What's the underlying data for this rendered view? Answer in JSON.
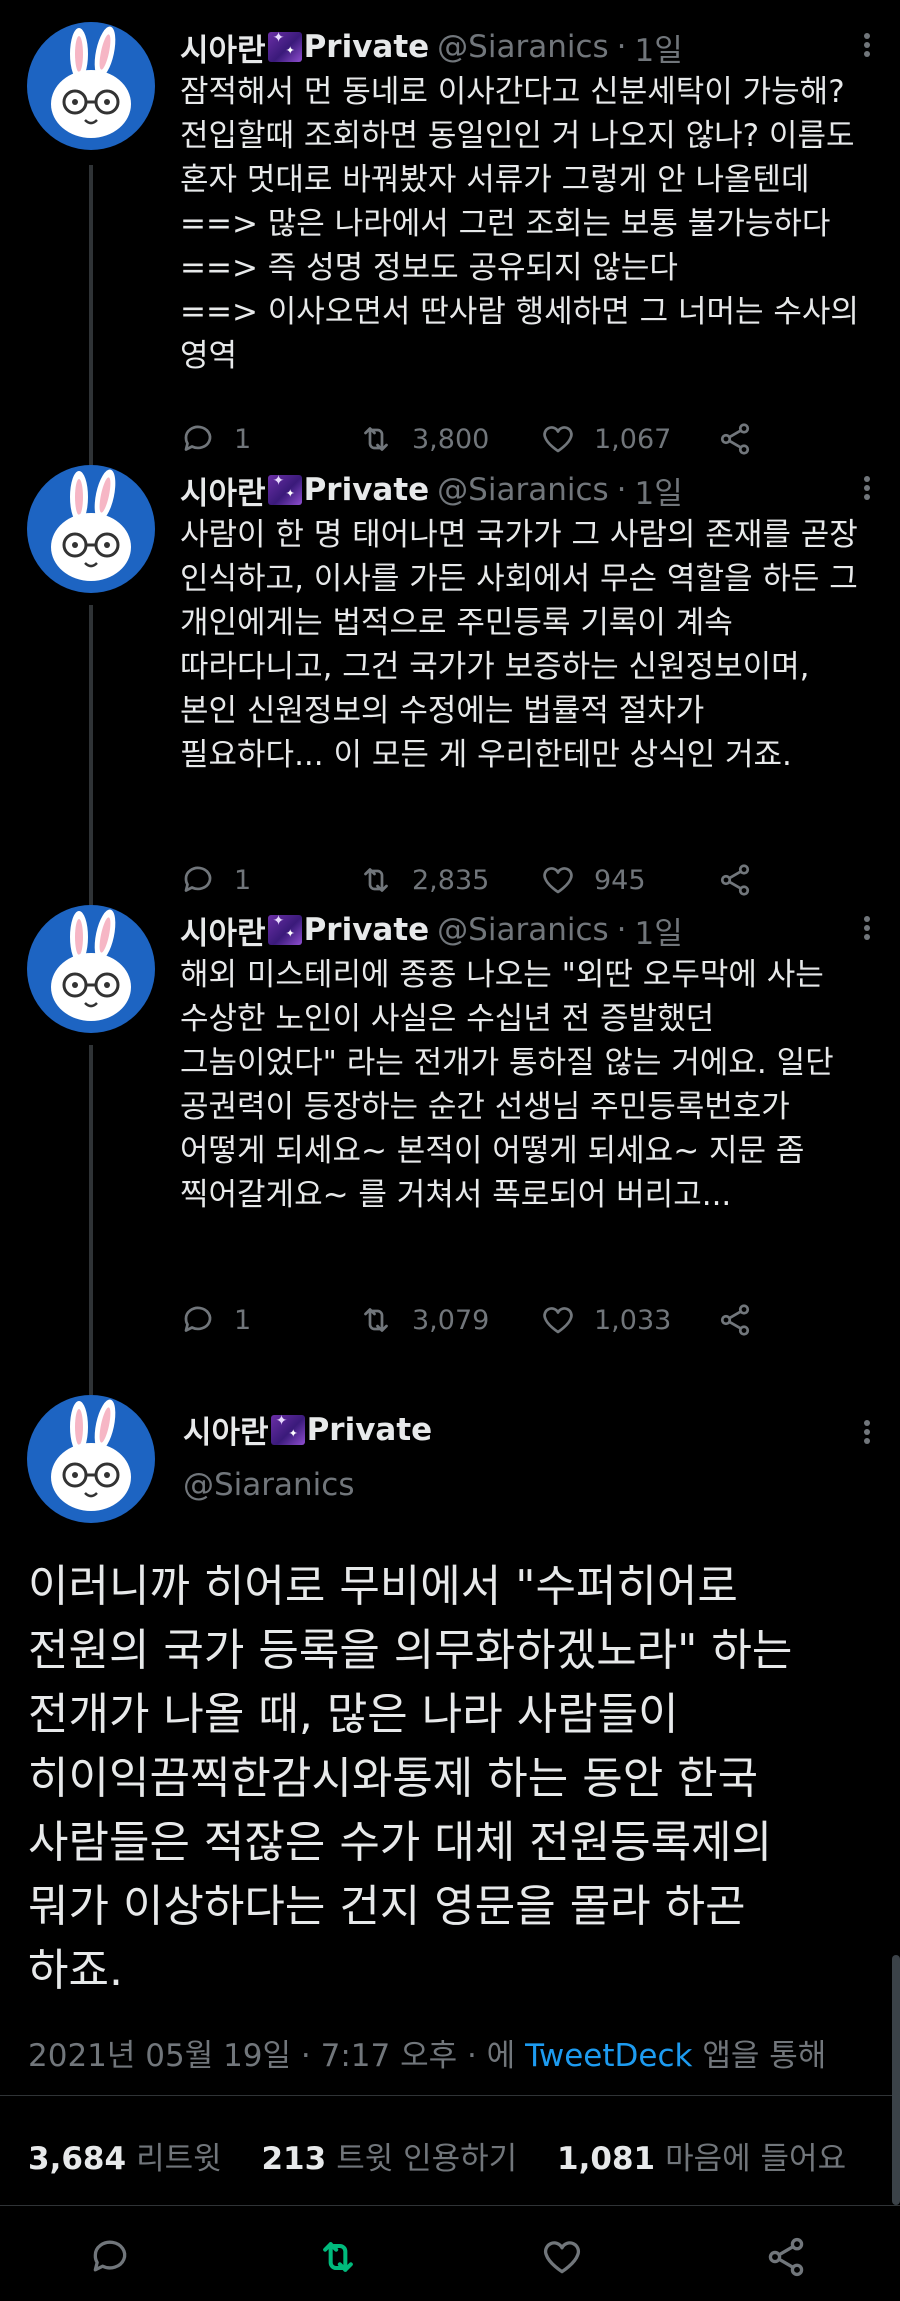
{
  "author": {
    "name": "시아란",
    "name_suffix": "Private",
    "handle": "@Siaranics",
    "avatar": "rabbit-avatar"
  },
  "tweets": [
    {
      "time": "1일",
      "lines": [
        "잠적해서 먼 동네로 이사간다고 신분세탁이 가능해?",
        "전입할때 조회하면 동일인인 거 나오지 않나? 이름도",
        "혼자 멋대로 바꿔봤자 서류가 그렇게 안 나올텐데",
        "==> 많은 나라에서 그런 조회는 보통 불가능하다",
        "==> 즉 성명 정보도 공유되지 않는다",
        "==> 이사오면서 딴사람 행세하면 그 너머는 수사의",
        "영역"
      ],
      "replies": "1",
      "retweets": "3,800",
      "likes": "1,067"
    },
    {
      "time": "1일",
      "lines": [
        "사람이 한 명 태어나면 국가가 그 사람의 존재를 곧장",
        "인식하고, 이사를 가든 사회에서 무슨 역할을 하든 그",
        "개인에게는 법적으로 주민등록 기록이 계속",
        "따라다니고, 그건 국가가 보증하는 신원정보이며,",
        "본인 신원정보의 수정에는 법률적 절차가",
        "필요하다... 이 모든 게 우리한테만 상식인 거죠."
      ],
      "replies": "1",
      "retweets": "2,835",
      "likes": "945"
    },
    {
      "time": "1일",
      "lines": [
        "해외 미스테리에 종종 나오는 \"외딴 오두막에 사는",
        "수상한 노인이 사실은 수십년 전 증발했던",
        "그놈이었다\" 라는 전개가 통하질 않는 거에요. 일단",
        "공권력이 등장하는 순간 선생님 주민등록번호가",
        "어떻게 되세요~ 본적이 어떻게 되세요~ 지문 좀",
        "찍어갈게요~ 를 거쳐서 폭로되어 버리고..."
      ],
      "replies": "1",
      "retweets": "3,079",
      "likes": "1,033"
    }
  ],
  "focused": {
    "lines": [
      "이러니까 히어로 무비에서 \"수퍼히어로",
      "전원의 국가 등록을 의무화하겠노라\" 하는",
      "전개가 나올 때, 많은 나라 사람들이",
      "히이익끔찍한감시와통제 하는 동안 한국",
      "사람들은 적잖은 수가 대체 전원등록제의",
      "뭐가 이상하다는 건지 영문을 몰라 하곤",
      "하죠."
    ],
    "timestamp": "2021년 05월 19일 · 7:17 오후 · 에",
    "source": "TweetDeck",
    "via": "앱을 통해",
    "retweets_count": "3,684",
    "retweets_label": "리트윗",
    "quotes_count": "213",
    "quotes_label": "트윗 인용하기",
    "likes_count": "1,081",
    "likes_label": "마음에 들어요",
    "retweeted": true,
    "retweet_color": "#00ba7c"
  }
}
